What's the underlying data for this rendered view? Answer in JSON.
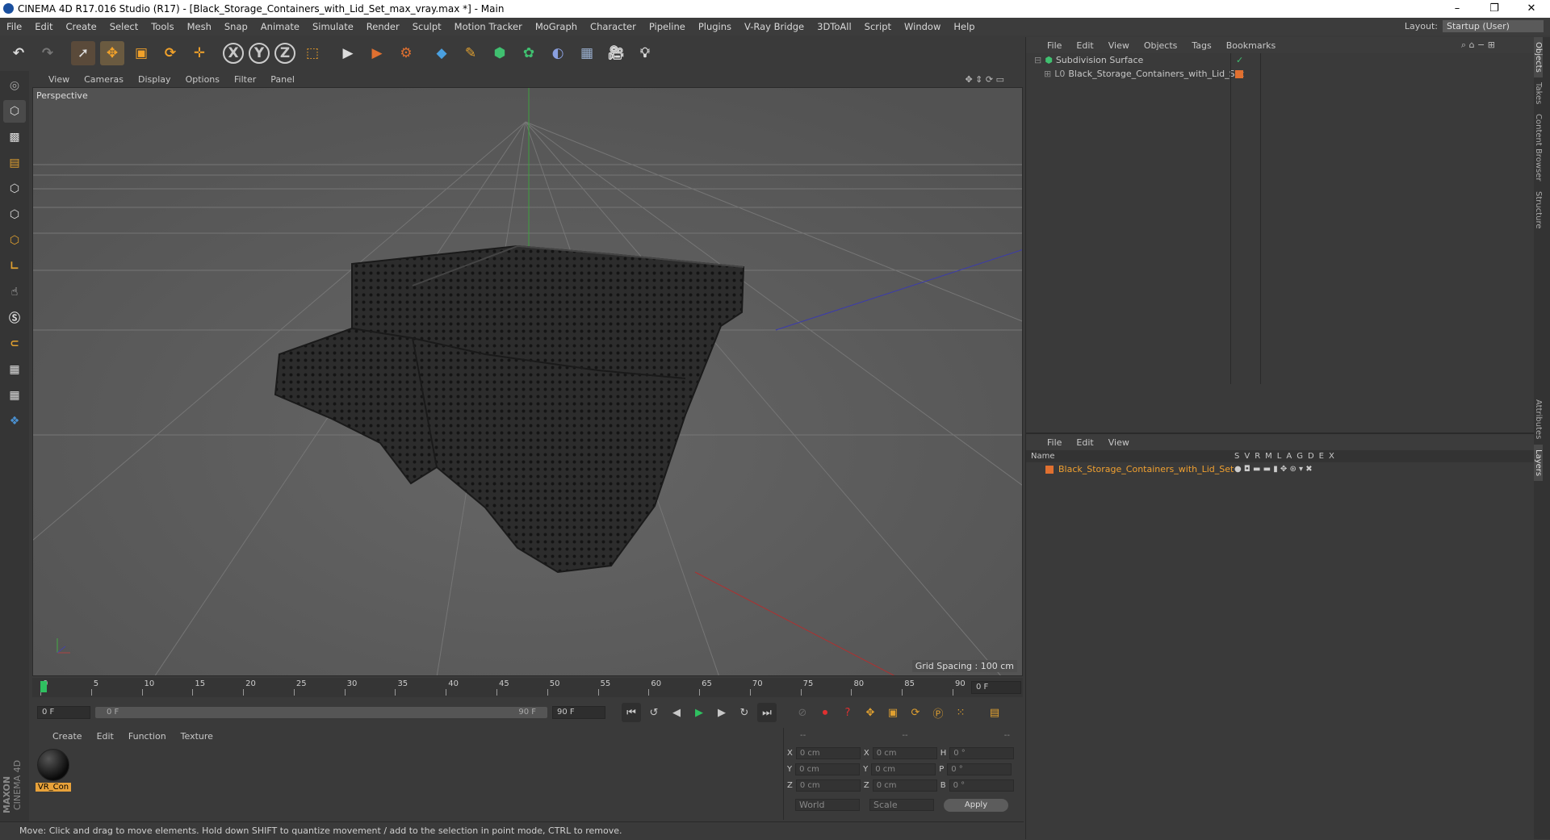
{
  "window": {
    "title": "CINEMA 4D R17.016 Studio (R17) - [Black_Storage_Containers_with_Lid_Set_max_vray.max *] - Main"
  },
  "menu": [
    "File",
    "Edit",
    "Create",
    "Select",
    "Tools",
    "Mesh",
    "Snap",
    "Animate",
    "Simulate",
    "Render",
    "Sculpt",
    "Motion Tracker",
    "MoGraph",
    "Character",
    "Pipeline",
    "Plugins",
    "V-Ray Bridge",
    "3DToAll",
    "Script",
    "Window",
    "Help"
  ],
  "layout": {
    "label": "Layout:",
    "value": "Startup (User)"
  },
  "toolbar": {
    "axis_x": "X",
    "axis_y": "Y",
    "axis_z": "Z"
  },
  "viewport": {
    "menu": [
      "View",
      "Cameras",
      "Display",
      "Options",
      "Filter",
      "Panel"
    ],
    "label": "Perspective",
    "grid_spacing": "Grid Spacing : 100 cm"
  },
  "timeline": {
    "ticks": [
      "0",
      "5",
      "10",
      "15",
      "20",
      "25",
      "30",
      "35",
      "40",
      "45",
      "50",
      "55",
      "60",
      "65",
      "70",
      "75",
      "80",
      "85",
      "90"
    ],
    "current_frame": "0 F"
  },
  "transport": {
    "start": "0 F",
    "range_start": "0 F",
    "range_end": "90 F",
    "end": "90 F"
  },
  "material_manager": {
    "menu": [
      "Create",
      "Edit",
      "Function",
      "Texture"
    ],
    "material_name": "VR_Con"
  },
  "coordinates": {
    "headers": [
      "--",
      "--",
      "--"
    ],
    "rows": [
      {
        "a": "X",
        "av": "0 cm",
        "b": "X",
        "bv": "0 cm",
        "c": "H",
        "cv": "0 °"
      },
      {
        "a": "Y",
        "av": "0 cm",
        "b": "Y",
        "bv": "0 cm",
        "c": "P",
        "cv": "0 °"
      },
      {
        "a": "Z",
        "av": "0 cm",
        "b": "Z",
        "bv": "0 cm",
        "c": "B",
        "cv": "0 °"
      }
    ],
    "mode1": "World",
    "mode2": "Scale",
    "apply": "Apply"
  },
  "status": "Move: Click and drag to move elements. Hold down SHIFT to quantize movement / add to the selection in point mode, CTRL to remove.",
  "objects_panel": {
    "menu": [
      "File",
      "Edit",
      "View",
      "Objects",
      "Tags",
      "Bookmarks"
    ],
    "items": [
      {
        "name": "Subdivision Surface"
      },
      {
        "name": "Black_Storage_Containers_with_Lid_Set"
      }
    ]
  },
  "layers_panel": {
    "menu": [
      "File",
      "Edit",
      "View"
    ],
    "header_name": "Name",
    "header_cols": [
      "S",
      "V",
      "R",
      "M",
      "L",
      "A",
      "G",
      "D",
      "E",
      "X"
    ],
    "layer": "Black_Storage_Containers_with_Lid_Set"
  },
  "side_tabs": [
    "Objects",
    "Takes",
    "Content Browser",
    "Structure",
    "Attributes",
    "Layers"
  ],
  "brand": {
    "maxon": "MAXON",
    "product": "CINEMA 4D"
  },
  "colors": {
    "accent": "#f0a030",
    "bg": "#3a3a3a",
    "viewport": "#5b5b5b"
  }
}
